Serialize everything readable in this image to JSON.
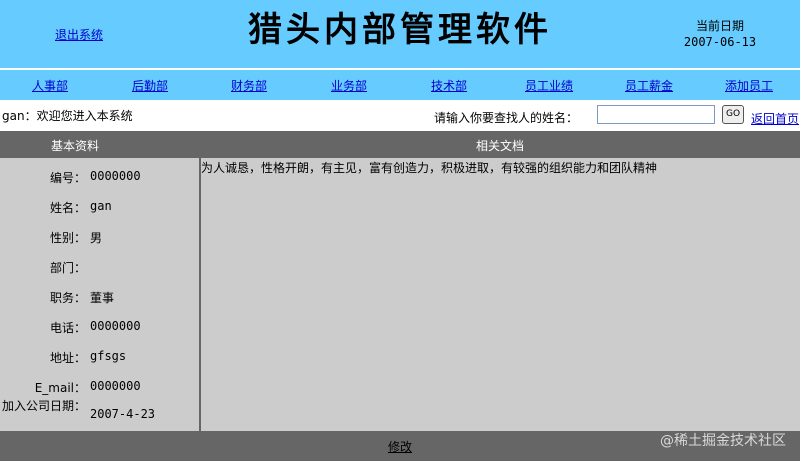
{
  "header": {
    "logout": "退出系统",
    "app_title": "猎头内部管理软件",
    "date_label": "当前日期",
    "date_value": "2007-06-13"
  },
  "nav": [
    "人事部",
    "后勤部",
    "财务部",
    "业务部",
    "技术部",
    "员工业绩",
    "员工薪金",
    "添加员工"
  ],
  "welcome": "gan：欢迎您进入本系统",
  "search": {
    "label": "请输入你要查找人的姓名：",
    "value": "",
    "go_label": "GO",
    "home_link": "返回首页"
  },
  "sections": {
    "basic": "基本资料",
    "docs": "相关文档"
  },
  "profile": [
    {
      "label": "编号：",
      "value": "0000000"
    },
    {
      "label": "姓名：",
      "value": "gan"
    },
    {
      "label": "性别：",
      "value": "男"
    },
    {
      "label": "部门：",
      "value": ""
    },
    {
      "label": "职务：",
      "value": "董事"
    },
    {
      "label": "电话：",
      "value": "0000000"
    },
    {
      "label": "地址：",
      "value": "gfsgs"
    },
    {
      "label": "E_mail：",
      "value": "0000000"
    },
    {
      "label": "加入公司日期：",
      "value": "2007-4-23"
    }
  ],
  "document_text": "为人诚恳，性格开朗，有主见，富有创造力，积极进取，有较强的组织能力和团队精神",
  "footer": {
    "edit": "修改"
  },
  "watermark": "@稀土掘金技术社区",
  "colors": {
    "header_bg": "#66ccff",
    "section_bg": "#666666",
    "panel_bg": "#cccccc",
    "link": "#0000cc"
  }
}
